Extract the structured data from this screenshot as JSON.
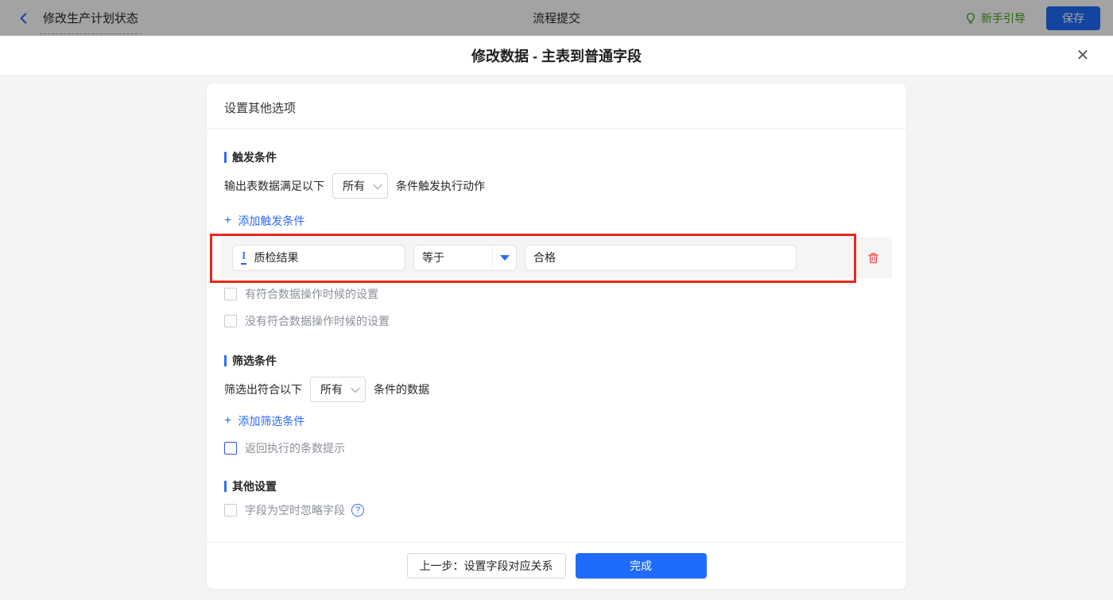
{
  "topbar": {
    "title": "修改生产计划状态",
    "center_title": "流程提交",
    "guide_label": "新手引导",
    "save_label": "保存"
  },
  "modal": {
    "title": "修改数据 - 主表到普通字段",
    "close_icon": "✕"
  },
  "panel": {
    "header": "设置其他选项",
    "trigger_section": {
      "title": "触发条件",
      "row_prefix": "输出表数据满足以下",
      "select_value": "所有",
      "row_suffix": "条件触发执行动作",
      "add_icon": "+",
      "add_label": "添加触发条件",
      "condition": {
        "field_type_glyph": "I",
        "field_value": "质检结果",
        "operator_value": "等于",
        "compare_value": "合格"
      },
      "checkbox_has_match": "有符合数据操作时候的设置",
      "checkbox_no_match": "没有符合数据操作时候的设置"
    },
    "filter_section": {
      "title": "筛选条件",
      "row_prefix": "筛选出符合以下",
      "select_value": "所有",
      "row_suffix": "条件的数据",
      "add_icon": "+",
      "add_label": "添加筛选条件",
      "checkbox_return_count": "返回执行的条数提示"
    },
    "other_section": {
      "title": "其他设置",
      "checkbox_ignore_empty": "字段为空时忽略字段",
      "help_glyph": "?"
    },
    "footer": {
      "prev_label": "上一步：设置字段对应关系",
      "done_label": "完成"
    }
  },
  "colors": {
    "accent_blue": "#1f6bfb",
    "link_blue": "#2f6bfb",
    "guide_green": "#43a114",
    "annotation_red": "#e8281d",
    "danger_red": "#f5494d",
    "mask": "rgba(0,0,0,0.36)"
  },
  "icons": {
    "back": "chevron-left",
    "guide": "lightbulb",
    "field_type": "text-type",
    "delete": "trash",
    "help": "question-circle",
    "close": "x",
    "select_arrow": "chevron-down",
    "operator_arrow": "triangle-down"
  }
}
